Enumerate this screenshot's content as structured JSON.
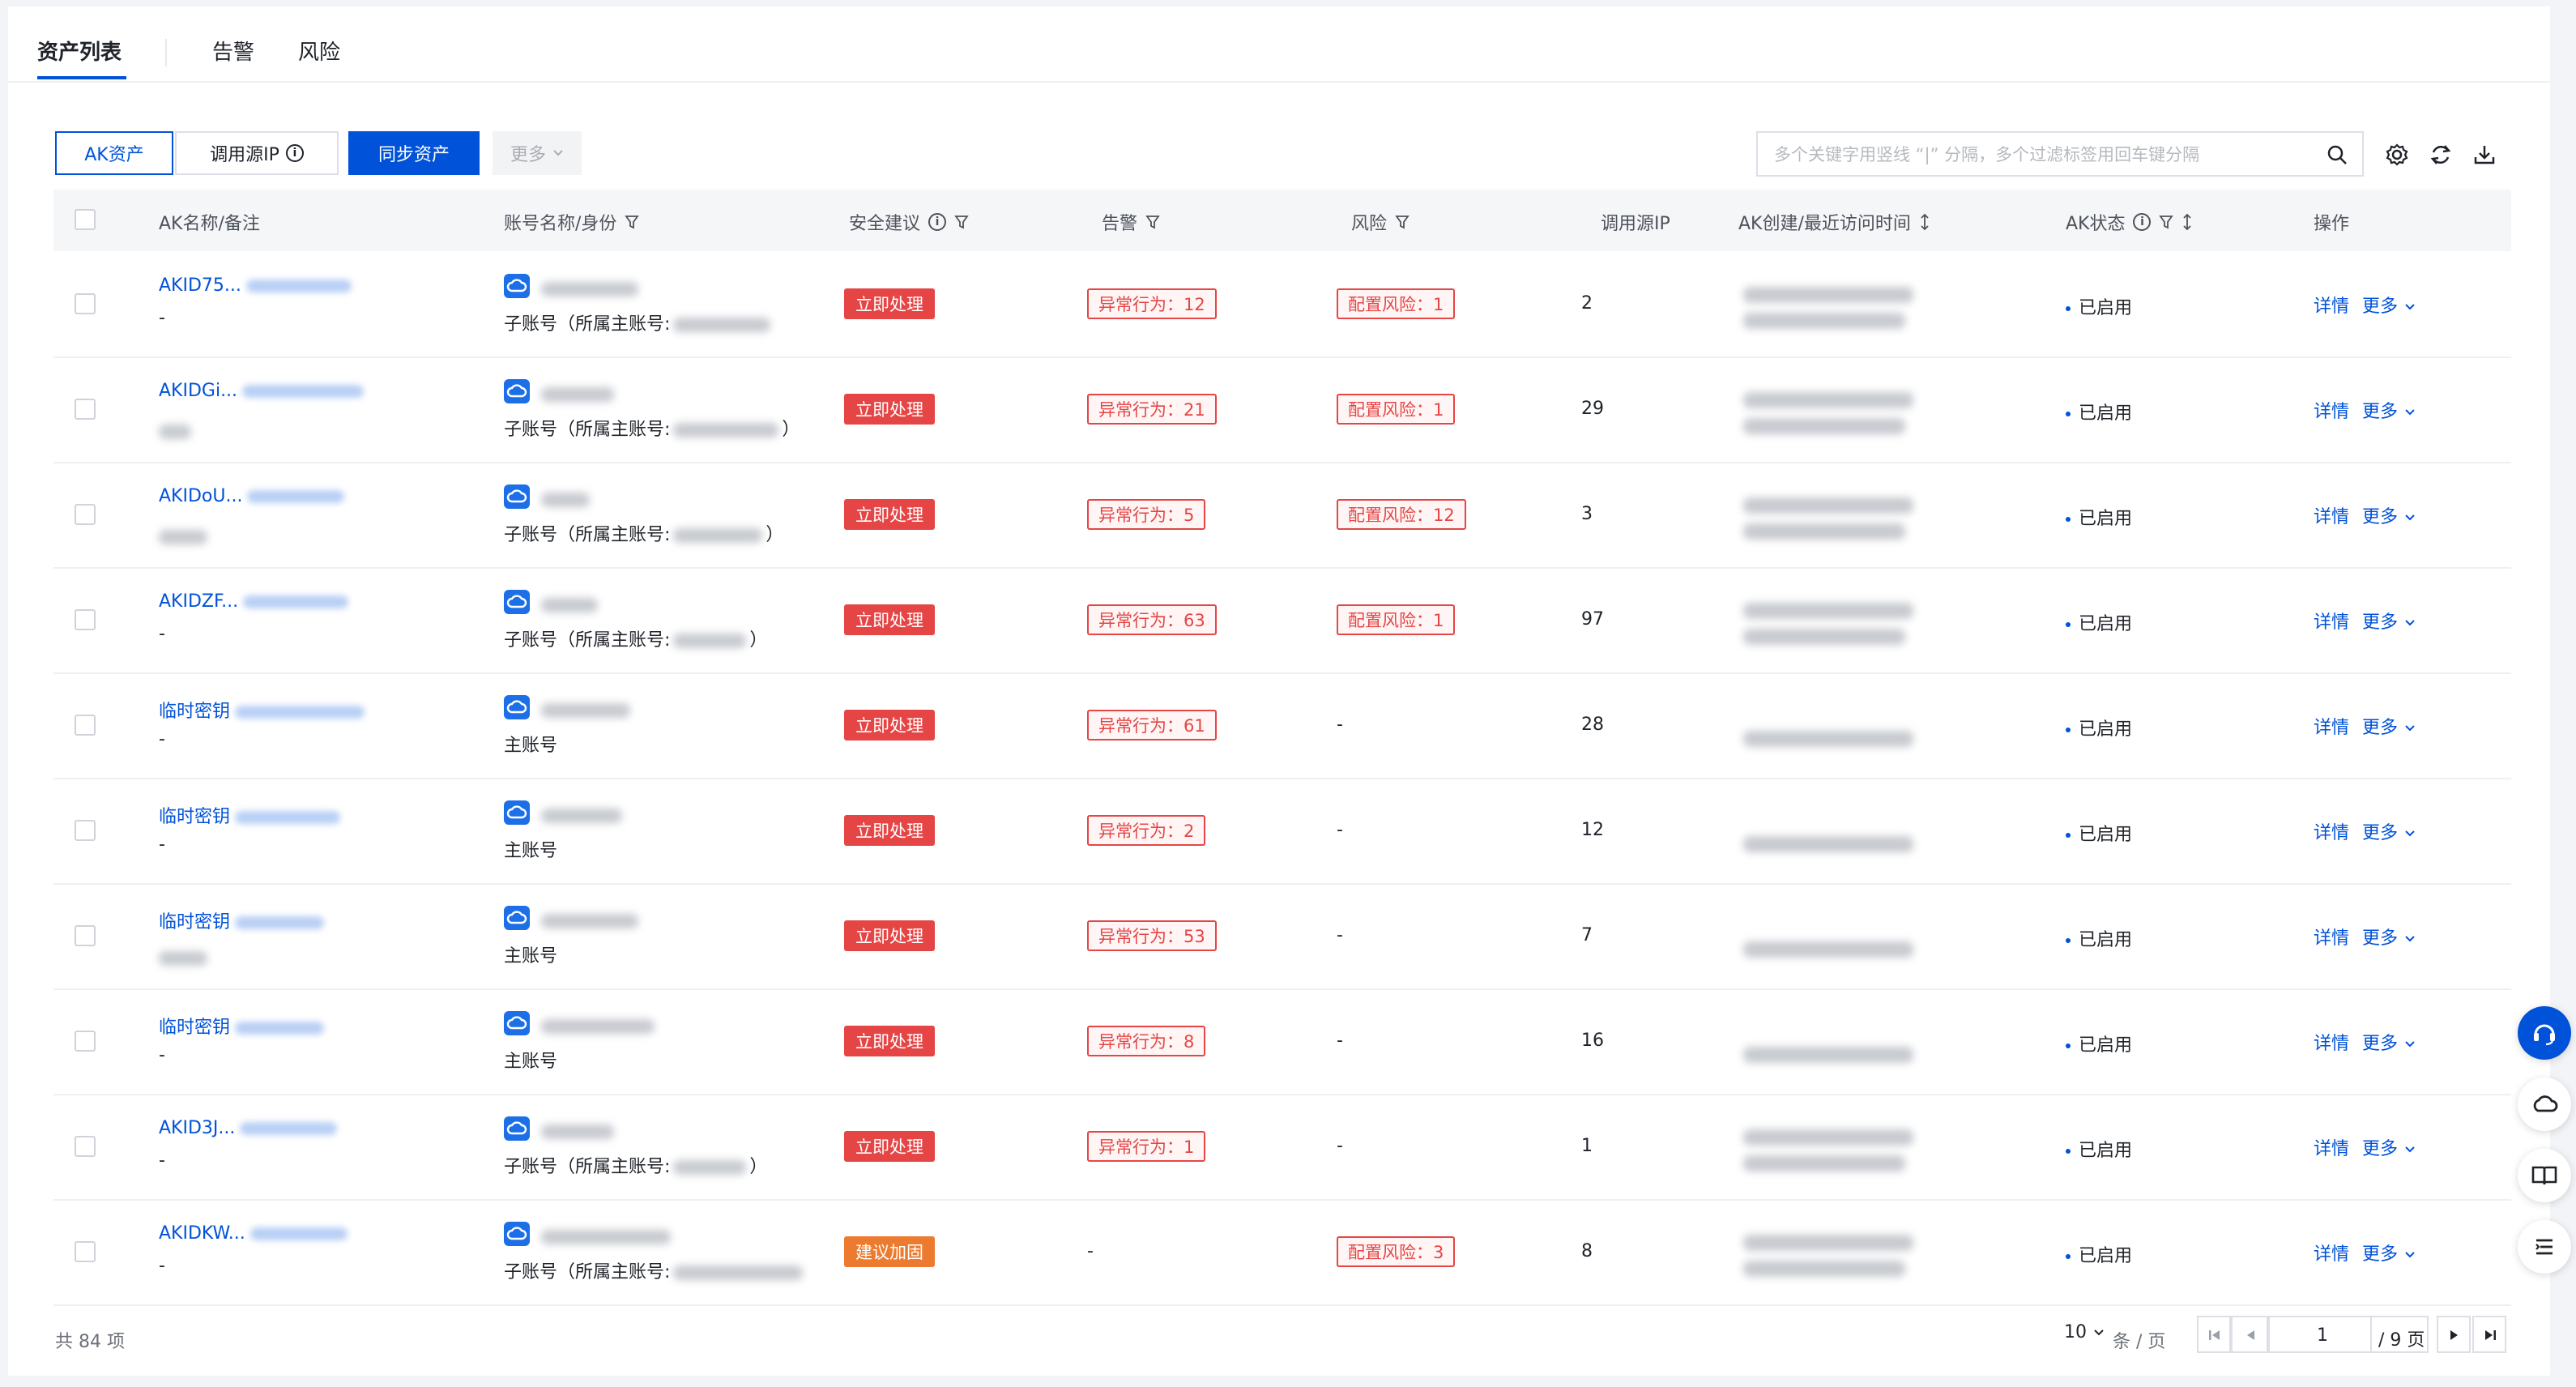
{
  "tabs": [
    {
      "label": "资产列表",
      "active": true
    },
    {
      "label": "告警",
      "active": false
    },
    {
      "label": "风险",
      "active": false
    }
  ],
  "toolbar": {
    "ak_assets": "AK资产",
    "caller_ip": "调用源IP",
    "sync_assets": "同步资产",
    "more": "更多"
  },
  "search": {
    "placeholder": "多个关键字用竖线 “|” 分隔，多个过滤标签用回车键分隔",
    "value": ""
  },
  "columns": {
    "ak_name": "AK名称/备注",
    "account": "账号名称/身份",
    "security": "安全建议",
    "alert": "告警",
    "risk": "风险",
    "caller_ip": "调用源IP",
    "time": "AK创建/最近访问时间",
    "status": "AK状态",
    "ops": "操作"
  },
  "rows": [
    {
      "ak": "AKID75...",
      "note": "-",
      "identity": "子账号（所属主账号:",
      "identity_end": "",
      "suggestion": "立即处理",
      "suggestion_type": "red",
      "alert": "异常行为：12",
      "risk": "配置风险：1",
      "ip": "2",
      "status": "已启用"
    },
    {
      "ak": "AKIDGi...",
      "note": "",
      "identity": "子账号（所属主账号:",
      "identity_end": "）",
      "suggestion": "立即处理",
      "suggestion_type": "red",
      "alert": "异常行为：21",
      "risk": "配置风险：1",
      "ip": "29",
      "status": "已启用"
    },
    {
      "ak": "AKIDoU...",
      "note": "",
      "identity": "子账号（所属主账号:",
      "identity_end": "）",
      "suggestion": "立即处理",
      "suggestion_type": "red",
      "alert": "异常行为：5",
      "risk": "配置风险：12",
      "ip": "3",
      "status": "已启用"
    },
    {
      "ak": "AKIDZF...",
      "note": "-",
      "identity": "子账号（所属主账号:",
      "identity_end": "）",
      "suggestion": "立即处理",
      "suggestion_type": "red",
      "alert": "异常行为：63",
      "risk": "配置风险：1",
      "ip": "97",
      "status": "已启用"
    },
    {
      "ak": "临时密钥",
      "note": "-",
      "identity": "主账号",
      "identity_end": "",
      "suggestion": "立即处理",
      "suggestion_type": "red",
      "alert": "异常行为：61",
      "risk": "-",
      "ip": "28",
      "status": "已启用"
    },
    {
      "ak": "临时密钥",
      "note": "-",
      "identity": "主账号",
      "identity_end": "",
      "suggestion": "立即处理",
      "suggestion_type": "red",
      "alert": "异常行为：2",
      "risk": "-",
      "ip": "12",
      "status": "已启用"
    },
    {
      "ak": "临时密钥",
      "note": "",
      "identity": "主账号",
      "identity_end": "",
      "suggestion": "立即处理",
      "suggestion_type": "red",
      "alert": "异常行为：53",
      "risk": "-",
      "ip": "7",
      "status": "已启用"
    },
    {
      "ak": "临时密钥",
      "note": "-",
      "identity": "主账号",
      "identity_end": "",
      "suggestion": "立即处理",
      "suggestion_type": "red",
      "alert": "异常行为：8",
      "risk": "-",
      "ip": "16",
      "status": "已启用"
    },
    {
      "ak": "AKID3J...",
      "note": "-",
      "identity": "子账号（所属主账号:",
      "identity_end": "）",
      "suggestion": "立即处理",
      "suggestion_type": "red",
      "alert": "异常行为：1",
      "risk": "-",
      "ip": "1",
      "status": "已启用"
    },
    {
      "ak": "AKIDKW...",
      "note": "-",
      "identity": "子账号（所属主账号:",
      "identity_end": "",
      "suggestion": "建议加固",
      "suggestion_type": "orange",
      "alert": "-",
      "risk": "配置风险：3",
      "ip": "8",
      "status": "已启用"
    }
  ],
  "row_actions": {
    "details": "详情",
    "more": "更多"
  },
  "footer": {
    "total": "共 84 项",
    "page_size": "10",
    "per_page": "条 / 页",
    "current_page": "1",
    "total_pages": "/ 9 页"
  },
  "colors": {
    "primary": "#0052d9",
    "danger": "#e54545",
    "warning": "#ed7b2f"
  }
}
